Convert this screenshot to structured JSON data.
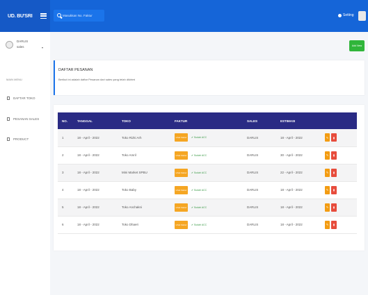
{
  "app": {
    "brand": "UD. BU'SRI"
  },
  "search": {
    "placeholder": "Masukkan No. Faktur"
  },
  "topbar": {
    "setting_label": "Setting"
  },
  "sidebar": {
    "user_name": "DARLIS",
    "user_role": "sales",
    "menu_header": "MAIN MENU",
    "items": [
      {
        "label": "DAFTAR TOKO",
        "icon": "document-icon"
      },
      {
        "label": "PESANAN SALES",
        "icon": "document-icon"
      },
      {
        "label": "PRODUCT",
        "icon": "document-icon"
      }
    ]
  },
  "toolbar": {
    "add_label": "Add New"
  },
  "hero": {
    "title": "DAFTAR PESANAN",
    "subtitle": "Berikut ini adalah daftar Pesanan dari sales yang telah dikirimi"
  },
  "table": {
    "headers": [
      "NO.",
      "TANGGAL",
      "TOKO",
      "FAKTUR",
      "SALES",
      "ESTIMASI",
      ""
    ],
    "faktur_button": "Lihat Faktur",
    "status_label": "Sudah ACC",
    "rows": [
      {
        "no": "1",
        "tanggal": "18 - April - 2022",
        "toko": "Toko Rizki Arh",
        "sales": "DARLIS",
        "estimasi": "18 - April - 2022"
      },
      {
        "no": "2",
        "tanggal": "18 - April - 2022",
        "toko": "Toko Amril",
        "sales": "DARLIS",
        "estimasi": "30 - April - 2022"
      },
      {
        "no": "3",
        "tanggal": "18 - April - 2022",
        "toko": "Mini Market SPBU",
        "sales": "DARLIS",
        "estimasi": "22 - April - 2022"
      },
      {
        "no": "4",
        "tanggal": "18 - April - 2022",
        "toko": "Toko Baby",
        "sales": "DARLIS",
        "estimasi": "18 - April - 2022"
      },
      {
        "no": "5",
        "tanggal": "18 - April - 2022",
        "toko": "Toko Anchakni",
        "sales": "DARLIS",
        "estimasi": "18 - April - 2022"
      },
      {
        "no": "6",
        "tanggal": "18 - April - 2022",
        "toko": "Toko Dhaeri",
        "sales": "DARLIS",
        "estimasi": "18 - April - 2022"
      }
    ]
  },
  "colors": {
    "topbar": "#1565d8",
    "table_header": "#2a2b84",
    "faktur_button": "#f5a623",
    "edit_button": "#f39c12",
    "delete_button": "#e74c3c",
    "add_button": "#30b53a"
  }
}
